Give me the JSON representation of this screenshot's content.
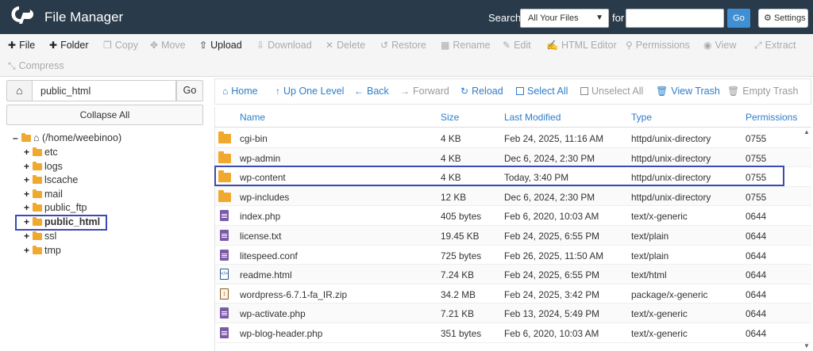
{
  "header": {
    "title": "File Manager",
    "search_label": "Search",
    "search_scope": "All Your Files",
    "for_label": "for",
    "search_value": "",
    "go_label": "Go",
    "settings_label": "Settings"
  },
  "toolbar": {
    "file": "File",
    "folder": "Folder",
    "copy": "Copy",
    "move": "Move",
    "upload": "Upload",
    "download": "Download",
    "delete": "Delete",
    "restore": "Restore",
    "rename": "Rename",
    "edit": "Edit",
    "html_editor": "HTML Editor",
    "permissions": "Permissions",
    "view": "View",
    "extract": "Extract",
    "compress": "Compress"
  },
  "left": {
    "path": "public_html",
    "go_label": "Go",
    "collapse_label": "Collapse All",
    "root": "(/home/weebinoo)",
    "folders": [
      "etc",
      "logs",
      "lscache",
      "mail",
      "public_ftp",
      "public_html",
      "ssl",
      "tmp"
    ],
    "selected": "public_html"
  },
  "nav": {
    "home": "Home",
    "up": "Up One Level",
    "back": "Back",
    "forward": "Forward",
    "reload": "Reload",
    "select_all": "Select All",
    "unselect_all": "Unselect All",
    "view_trash": "View Trash",
    "empty_trash": "Empty Trash"
  },
  "table": {
    "headers": {
      "name": "Name",
      "size": "Size",
      "modified": "Last Modified",
      "type": "Type",
      "perms": "Permissions"
    },
    "rows": [
      {
        "icon": "folder",
        "name": "cgi-bin",
        "size": "4 KB",
        "modified": "Feb 24, 2025, 11:16 AM",
        "type": "httpd/unix-directory",
        "perms": "0755"
      },
      {
        "icon": "folder",
        "name": "wp-admin",
        "size": "4 KB",
        "modified": "Dec 6, 2024, 2:30 PM",
        "type": "httpd/unix-directory",
        "perms": "0755"
      },
      {
        "icon": "folder",
        "name": "wp-content",
        "size": "4 KB",
        "modified": "Today, 3:40 PM",
        "type": "httpd/unix-directory",
        "perms": "0755"
      },
      {
        "icon": "folder",
        "name": "wp-includes",
        "size": "12 KB",
        "modified": "Dec 6, 2024, 2:30 PM",
        "type": "httpd/unix-directory",
        "perms": "0755"
      },
      {
        "icon": "doc",
        "name": "index.php",
        "size": "405 bytes",
        "modified": "Feb 6, 2020, 10:03 AM",
        "type": "text/x-generic",
        "perms": "0644"
      },
      {
        "icon": "doc",
        "name": "license.txt",
        "size": "19.45 KB",
        "modified": "Feb 24, 2025, 6:55 PM",
        "type": "text/plain",
        "perms": "0644"
      },
      {
        "icon": "doc",
        "name": "litespeed.conf",
        "size": "725 bytes",
        "modified": "Feb 26, 2025, 11:50 AM",
        "type": "text/plain",
        "perms": "0644"
      },
      {
        "icon": "html",
        "name": "readme.html",
        "size": "7.24 KB",
        "modified": "Feb 24, 2025, 6:55 PM",
        "type": "text/html",
        "perms": "0644"
      },
      {
        "icon": "zip",
        "name": "wordpress-6.7.1-fa_IR.zip",
        "size": "34.2 MB",
        "modified": "Feb 24, 2025, 3:42 PM",
        "type": "package/x-generic",
        "perms": "0644"
      },
      {
        "icon": "doc",
        "name": "wp-activate.php",
        "size": "7.21 KB",
        "modified": "Feb 13, 2024, 5:49 PM",
        "type": "text/x-generic",
        "perms": "0644"
      },
      {
        "icon": "doc",
        "name": "wp-blog-header.php",
        "size": "351 bytes",
        "modified": "Feb 6, 2020, 10:03 AM",
        "type": "text/x-generic",
        "perms": "0644"
      }
    ],
    "highlighted": "wp-content"
  },
  "colors": {
    "header_bg": "#293a4a",
    "link": "#2d7dc7",
    "folder": "#f0a92e",
    "highlight": "#3a4bb5"
  }
}
